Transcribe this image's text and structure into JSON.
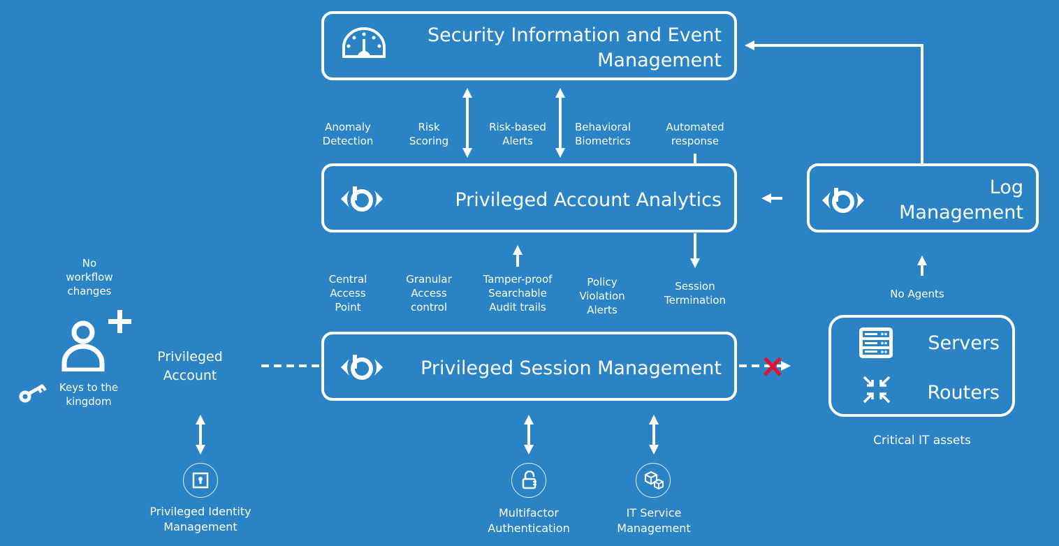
{
  "siem": {
    "title_line1": "Security Information and Event",
    "title_line2": "Management"
  },
  "paa": {
    "title": "Privileged Account Analytics"
  },
  "log": {
    "title_line1": "Log",
    "title_line2": "Management"
  },
  "psm": {
    "title": "Privileged Session Management"
  },
  "analytics_features": [
    {
      "line1": "Anomaly",
      "line2": "Detection"
    },
    {
      "line1": "Risk",
      "line2": "Scoring"
    },
    {
      "line1": "Risk-based",
      "line2": "Alerts"
    },
    {
      "line1": "Behavioral",
      "line2": "Biometrics"
    },
    {
      "line1": "Automated",
      "line2": "response"
    }
  ],
  "session_features": [
    {
      "line1": "Central",
      "line2": "Access",
      "line3": "Point"
    },
    {
      "line1": "Granular",
      "line2": "Access",
      "line3": "control"
    },
    {
      "line1": "Tamper-proof",
      "line2": "Searchable",
      "line3": "Audit trails"
    },
    {
      "line1": "Policy",
      "line2": "Violation",
      "line3": "Alerts"
    },
    {
      "line1": "Session",
      "line2": "Termination"
    }
  ],
  "user": {
    "no_workflow_line1": "No",
    "no_workflow_line2": "workflow",
    "no_workflow_line3": "changes",
    "keys_line1": "Keys to the",
    "keys_line2": "kingdom",
    "account_line1": "Privileged",
    "account_line2": "Account"
  },
  "assets": {
    "servers": "Servers",
    "routers": "Routers",
    "caption": "Critical IT assets",
    "no_agents": "No Agents"
  },
  "integrations": {
    "pim_line1": "Privileged Identity",
    "pim_line2": "Management",
    "mfa_line1": "Multifactor",
    "mfa_line2": "Authentication",
    "itsm_line1": "IT Service",
    "itsm_line2": "Management"
  },
  "colors": {
    "background": "#2a83c4",
    "foreground": "#ffffff",
    "blocked": "#e8112d"
  }
}
